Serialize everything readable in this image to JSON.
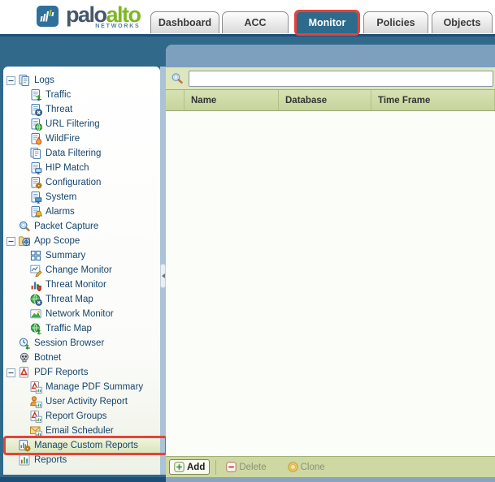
{
  "header": {
    "logo": {
      "brand_primary": "palo",
      "brand_secondary": "alto",
      "brand_sub": "NETWORKS"
    },
    "tabs": [
      {
        "label": "Dashboard",
        "active": false,
        "highlighted": false
      },
      {
        "label": "ACC",
        "active": false,
        "highlighted": false
      },
      {
        "label": "Monitor",
        "active": true,
        "highlighted": true
      },
      {
        "label": "Policies",
        "active": false,
        "highlighted": false
      },
      {
        "label": "Objects",
        "active": false,
        "highlighted": false
      }
    ]
  },
  "sidebar": {
    "items": [
      {
        "label": "Logs",
        "icon": "logs-icon",
        "level": 0,
        "expander": true,
        "expanded": true,
        "selected": false,
        "highlighted": false
      },
      {
        "label": "Traffic",
        "icon": "traffic-log-icon",
        "level": 1,
        "expander": false,
        "selected": false,
        "highlighted": false
      },
      {
        "label": "Threat",
        "icon": "threat-log-icon",
        "level": 1,
        "expander": false,
        "selected": false,
        "highlighted": false
      },
      {
        "label": "URL Filtering",
        "icon": "url-filtering-icon",
        "level": 1,
        "expander": false,
        "selected": false,
        "highlighted": false
      },
      {
        "label": "WildFire",
        "icon": "wildfire-icon",
        "level": 1,
        "expander": false,
        "selected": false,
        "highlighted": false
      },
      {
        "label": "Data Filtering",
        "icon": "data-filtering-icon",
        "level": 1,
        "expander": false,
        "selected": false,
        "highlighted": false
      },
      {
        "label": "HIP Match",
        "icon": "hip-match-icon",
        "level": 1,
        "expander": false,
        "selected": false,
        "highlighted": false
      },
      {
        "label": "Configuration",
        "icon": "configuration-log-icon",
        "level": 1,
        "expander": false,
        "selected": false,
        "highlighted": false
      },
      {
        "label": "System",
        "icon": "system-log-icon",
        "level": 1,
        "expander": false,
        "selected": false,
        "highlighted": false
      },
      {
        "label": "Alarms",
        "icon": "alarms-icon",
        "level": 1,
        "expander": false,
        "selected": false,
        "highlighted": false
      },
      {
        "label": "Packet Capture",
        "icon": "packet-capture-icon",
        "level": 0,
        "expander": false,
        "selected": false,
        "highlighted": false
      },
      {
        "label": "App Scope",
        "icon": "app-scope-icon",
        "level": 0,
        "expander": true,
        "expanded": true,
        "selected": false,
        "highlighted": false
      },
      {
        "label": "Summary",
        "icon": "summary-icon",
        "level": 1,
        "expander": false,
        "selected": false,
        "highlighted": false
      },
      {
        "label": "Change Monitor",
        "icon": "change-monitor-icon",
        "level": 1,
        "expander": false,
        "selected": false,
        "highlighted": false
      },
      {
        "label": "Threat Monitor",
        "icon": "threat-monitor-icon",
        "level": 1,
        "expander": false,
        "selected": false,
        "highlighted": false
      },
      {
        "label": "Threat Map",
        "icon": "threat-map-icon",
        "level": 1,
        "expander": false,
        "selected": false,
        "highlighted": false
      },
      {
        "label": "Network Monitor",
        "icon": "network-monitor-icon",
        "level": 1,
        "expander": false,
        "selected": false,
        "highlighted": false
      },
      {
        "label": "Traffic Map",
        "icon": "traffic-map-icon",
        "level": 1,
        "expander": false,
        "selected": false,
        "highlighted": false
      },
      {
        "label": "Session Browser",
        "icon": "session-browser-icon",
        "level": 0,
        "expander": false,
        "selected": false,
        "highlighted": false
      },
      {
        "label": "Botnet",
        "icon": "botnet-icon",
        "level": 0,
        "expander": false,
        "selected": false,
        "highlighted": false
      },
      {
        "label": "PDF Reports",
        "icon": "pdf-reports-icon",
        "level": 0,
        "expander": true,
        "expanded": true,
        "selected": false,
        "highlighted": false
      },
      {
        "label": "Manage PDF Summary",
        "icon": "manage-pdf-summary-icon",
        "level": 1,
        "expander": false,
        "selected": false,
        "highlighted": false
      },
      {
        "label": "User Activity Report",
        "icon": "user-activity-report-icon",
        "level": 1,
        "expander": false,
        "selected": false,
        "highlighted": false
      },
      {
        "label": "Report Groups",
        "icon": "report-groups-icon",
        "level": 1,
        "expander": false,
        "selected": false,
        "highlighted": false
      },
      {
        "label": "Email Scheduler",
        "icon": "email-scheduler-icon",
        "level": 1,
        "expander": false,
        "selected": false,
        "highlighted": false
      },
      {
        "label": "Manage Custom Reports",
        "icon": "manage-custom-reports-icon",
        "level": 0,
        "expander": false,
        "selected": true,
        "highlighted": true
      },
      {
        "label": "Reports",
        "icon": "reports-icon",
        "level": 0,
        "expander": false,
        "selected": false,
        "highlighted": false
      }
    ]
  },
  "main": {
    "search": {
      "value": "",
      "icon": "search-icon"
    },
    "table": {
      "columns": [
        "Name",
        "Database",
        "Time Frame"
      ],
      "rows": []
    },
    "toolbar": {
      "add_label": "Add",
      "delete_label": "Delete",
      "clone_label": "Clone",
      "add_enabled": true,
      "delete_enabled": false,
      "clone_enabled": false
    }
  },
  "colors": {
    "highlight_red": "#e8413a",
    "active_tab_teal": "#2d6b8d",
    "page_teal": "#31698a",
    "navy_bar": "#1d4e78",
    "panel_band_slate": "#7da0bf",
    "toolbar_green": "#dde6bd",
    "table_header_green": "#ccd9a4",
    "brand_green": "#7db723",
    "brand_slate": "#44586c"
  }
}
